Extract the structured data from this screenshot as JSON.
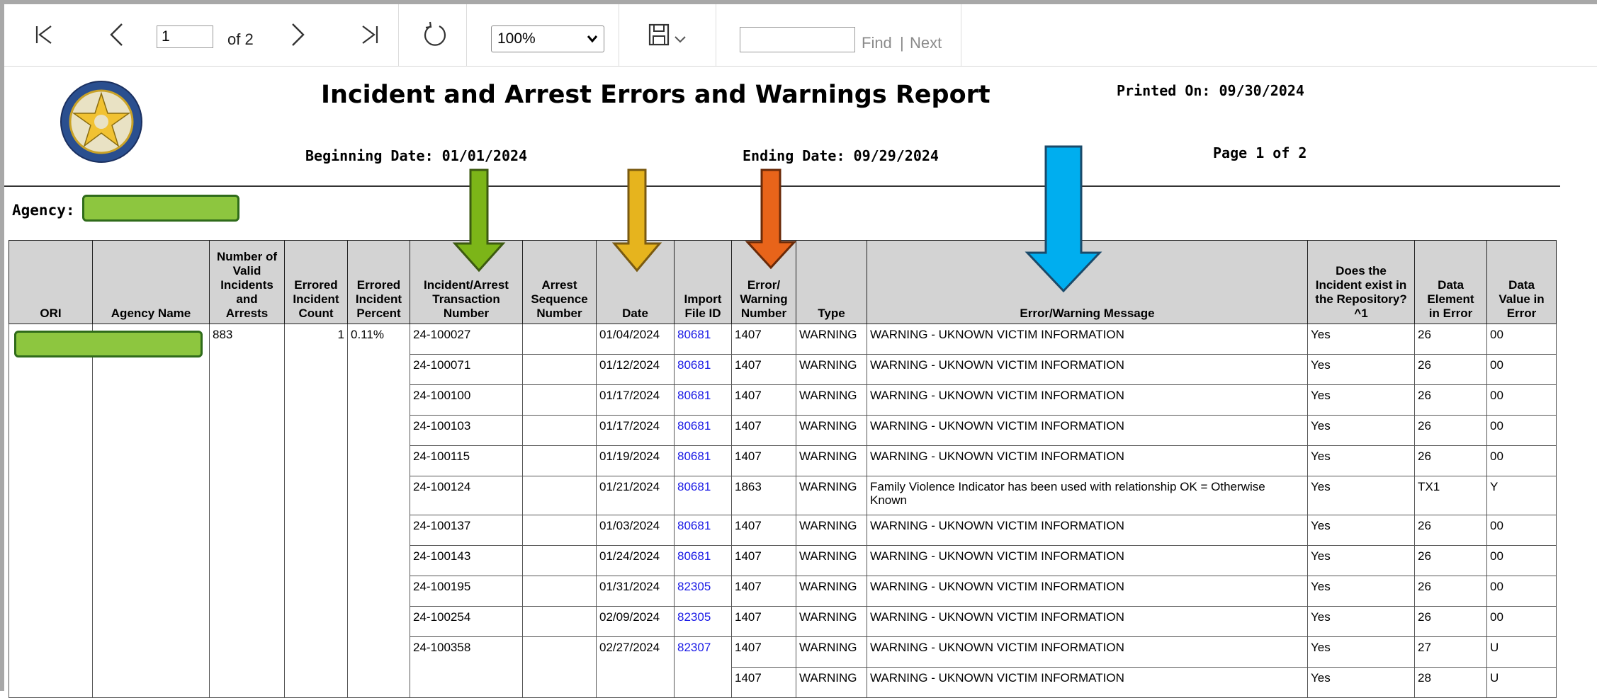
{
  "toolbar": {
    "page_value": "1",
    "of_pages": "of 2",
    "zoom_value": "100%",
    "find_placeholder": "",
    "find_label": "Find",
    "separator": "|",
    "next_label": "Next"
  },
  "report": {
    "title": "Incident and Arrest Errors and Warnings Report",
    "printed_on": "Printed On: 09/30/2024",
    "beginning_date": "Beginning Date: 01/01/2024",
    "ending_date": "Ending Date: 09/29/2024",
    "page_info": "Page 1 of 2",
    "agency_label": "Agency:"
  },
  "table": {
    "headers": {
      "ori": "ORI",
      "agency_name": "Agency Name",
      "valid": [
        "Number of",
        "Valid",
        "Incidents",
        "and",
        "Arrests"
      ],
      "errored_count": [
        "Errored",
        "Incident",
        "Count"
      ],
      "errored_percent": [
        "Errored",
        "Incident",
        "Percent"
      ],
      "transaction": [
        "Incident/Arrest",
        "Transaction",
        "Number"
      ],
      "arrest_seq": [
        "Arrest",
        "Sequence",
        "Number"
      ],
      "date": "Date",
      "import_file": [
        "Import",
        "File ID"
      ],
      "error_number": [
        "Error/",
        "Warning",
        "Number"
      ],
      "type": "Type",
      "message": "Error/Warning Message",
      "in_repo": [
        "Does the",
        "Incident exist in",
        "the Repository?",
        "^1"
      ],
      "data_element": [
        "Data",
        "Element",
        "in Error"
      ],
      "data_value": [
        "Data",
        "Value in",
        "Error"
      ]
    },
    "summary": {
      "valid_count": "883",
      "errored_count": "1",
      "errored_percent": "0.11%"
    },
    "rows": [
      {
        "txn": "24-100027",
        "date": "01/04/2024",
        "file": "80681",
        "num": "1407",
        "type": "WARNING",
        "msg": "WARNING - UKNOWN VICTIM INFORMATION",
        "repo": "Yes",
        "elem": "26",
        "val": "00"
      },
      {
        "txn": "24-100071",
        "date": "01/12/2024",
        "file": "80681",
        "num": "1407",
        "type": "WARNING",
        "msg": "WARNING - UKNOWN VICTIM INFORMATION",
        "repo": "Yes",
        "elem": "26",
        "val": "00"
      },
      {
        "txn": "24-100100",
        "date": "01/17/2024",
        "file": "80681",
        "num": "1407",
        "type": "WARNING",
        "msg": "WARNING - UKNOWN VICTIM INFORMATION",
        "repo": "Yes",
        "elem": "26",
        "val": "00"
      },
      {
        "txn": "24-100103",
        "date": "01/17/2024",
        "file": "80681",
        "num": "1407",
        "type": "WARNING",
        "msg": "WARNING - UKNOWN VICTIM INFORMATION",
        "repo": "Yes",
        "elem": "26",
        "val": "00"
      },
      {
        "txn": "24-100115",
        "date": "01/19/2024",
        "file": "80681",
        "num": "1407",
        "type": "WARNING",
        "msg": "WARNING - UKNOWN VICTIM INFORMATION",
        "repo": "Yes",
        "elem": "26",
        "val": "00"
      },
      {
        "txn": "24-100124",
        "date": "01/21/2024",
        "file": "80681",
        "num": "1863",
        "type": "WARNING",
        "msg": "Family Violence Indicator has been used with relationship OK = Otherwise Known",
        "repo": "Yes",
        "elem": "TX1",
        "val": "Y"
      },
      {
        "txn": "24-100137",
        "date": "01/03/2024",
        "file": "80681",
        "num": "1407",
        "type": "WARNING",
        "msg": "WARNING - UKNOWN VICTIM INFORMATION",
        "repo": "Yes",
        "elem": "26",
        "val": "00"
      },
      {
        "txn": "24-100143",
        "date": "01/24/2024",
        "file": "80681",
        "num": "1407",
        "type": "WARNING",
        "msg": "WARNING - UKNOWN VICTIM INFORMATION",
        "repo": "Yes",
        "elem": "26",
        "val": "00"
      },
      {
        "txn": "24-100195",
        "date": "01/31/2024",
        "file": "82305",
        "num": "1407",
        "type": "WARNING",
        "msg": "WARNING - UKNOWN VICTIM INFORMATION",
        "repo": "Yes",
        "elem": "26",
        "val": "00"
      },
      {
        "txn": "24-100254",
        "date": "02/09/2024",
        "file": "82305",
        "num": "1407",
        "type": "WARNING",
        "msg": "WARNING - UKNOWN VICTIM INFORMATION",
        "repo": "Yes",
        "elem": "26",
        "val": "00"
      },
      {
        "txn": "24-100358",
        "date": "02/27/2024",
        "file": "82307",
        "num": "1407",
        "type": "WARNING",
        "msg": "WARNING - UKNOWN VICTIM INFORMATION",
        "repo": "Yes",
        "elem": "27",
        "val": "U"
      },
      {
        "txn": "",
        "date": "",
        "file": "",
        "num": "1407",
        "type": "WARNING",
        "msg": "WARNING - UKNOWN VICTIM INFORMATION",
        "repo": "Yes",
        "elem": "28",
        "val": "U"
      }
    ]
  },
  "colors": {
    "arrow_green": "#7cb518",
    "arrow_yellow": "#e6b41e",
    "arrow_orange": "#e8641a",
    "arrow_blue": "#00aeef",
    "redaction_green": "#8dc63f",
    "header_gray": "#d3d3d3",
    "link_blue": "#1a1ae6"
  },
  "icons": {
    "first": "first-page-icon",
    "prev": "previous-page-icon",
    "next": "next-page-icon",
    "last": "last-page-icon",
    "refresh": "refresh-icon",
    "save": "save-icon",
    "logo": "texas-dps-seal-logo"
  }
}
